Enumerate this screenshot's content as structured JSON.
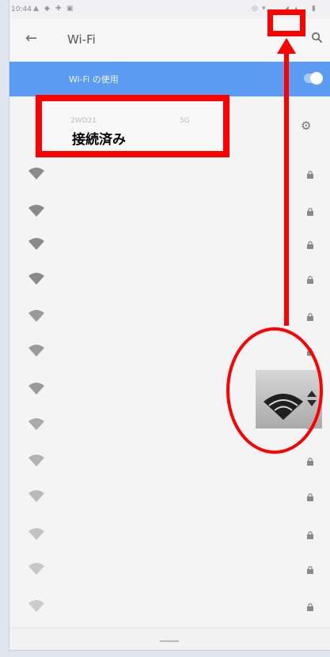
{
  "status_bar": {
    "time": "10:44",
    "icons": [
      "notification-a-icon",
      "notification-b-icon",
      "wifi-icon",
      "signal-icon",
      "battery-icon"
    ]
  },
  "app_bar": {
    "title": "Wi-Fi",
    "back_icon": "arrow-back-icon",
    "search_icon": "search-icon"
  },
  "wifi_toggle": {
    "label": "Wi-Fi の使用",
    "enabled": true
  },
  "connected_network": {
    "name": "2WD21",
    "band": "5G",
    "status": "接続済み"
  },
  "networks_count_hint": "12",
  "annotation": {
    "callout_text": "接続済み",
    "accent": "#ff0000"
  },
  "colors": {
    "toggle_row": "#5b9bf1",
    "background": "#f4f4f5"
  }
}
